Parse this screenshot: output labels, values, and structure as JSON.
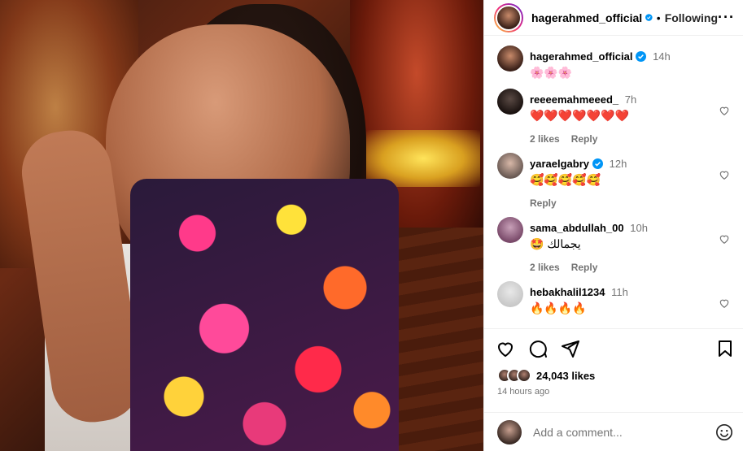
{
  "header": {
    "username": "hagerahmed_official",
    "dot": "•",
    "follow_status": "Following",
    "more": "···"
  },
  "comments": [
    {
      "user": "hagerahmed_official",
      "verified": true,
      "time": "14h",
      "text": "🌸🌸🌸",
      "likes": "",
      "reply": "",
      "heart": false
    },
    {
      "user": "reeeemahmeeed_",
      "verified": false,
      "time": "7h",
      "text": "❤️❤️❤️❤️❤️❤️❤️",
      "likes": "2 likes",
      "reply": "Reply",
      "heart": true
    },
    {
      "user": "yaraelgabry",
      "verified": true,
      "time": "12h",
      "text": "🥰🥰🥰🥰🥰",
      "likes": "",
      "reply": "Reply",
      "heart": true
    },
    {
      "user": "sama_abdullah_00",
      "verified": false,
      "time": "10h",
      "text": "🤩 يجمالك",
      "likes": "2 likes",
      "reply": "Reply",
      "heart": true
    },
    {
      "user": "hebakhalil1234",
      "verified": false,
      "time": "11h",
      "text": "🔥🔥🔥🔥",
      "likes": "",
      "reply": "",
      "heart": true
    }
  ],
  "likes": {
    "count": "24,043 likes"
  },
  "posted_ago": "14 hours ago",
  "add_comment": {
    "placeholder": "Add a comment..."
  },
  "colors": {
    "verified": "#0095f6",
    "muted": "#737373",
    "border": "#efefef"
  }
}
